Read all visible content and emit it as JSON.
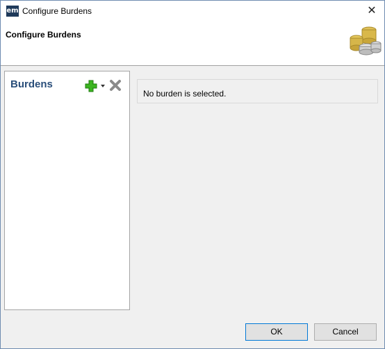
{
  "window": {
    "title": "Configure Burdens",
    "app_icon_text": "em",
    "close_symbol": "✕"
  },
  "header": {
    "title": "Configure Burdens",
    "icon": "coins-icon"
  },
  "sidebar": {
    "title": "Burdens",
    "add_icon": "plus-icon",
    "dropdown_icon": "chevron-down-icon",
    "delete_icon": "close-icon"
  },
  "detail": {
    "message": "No burden is selected."
  },
  "buttons": {
    "ok": "OK",
    "cancel": "Cancel"
  },
  "colors": {
    "accent": "#0078d7",
    "sidebar_title": "#2a4e7a",
    "add_green": "#3cb521",
    "delete_gray": "#8a8a8a"
  }
}
